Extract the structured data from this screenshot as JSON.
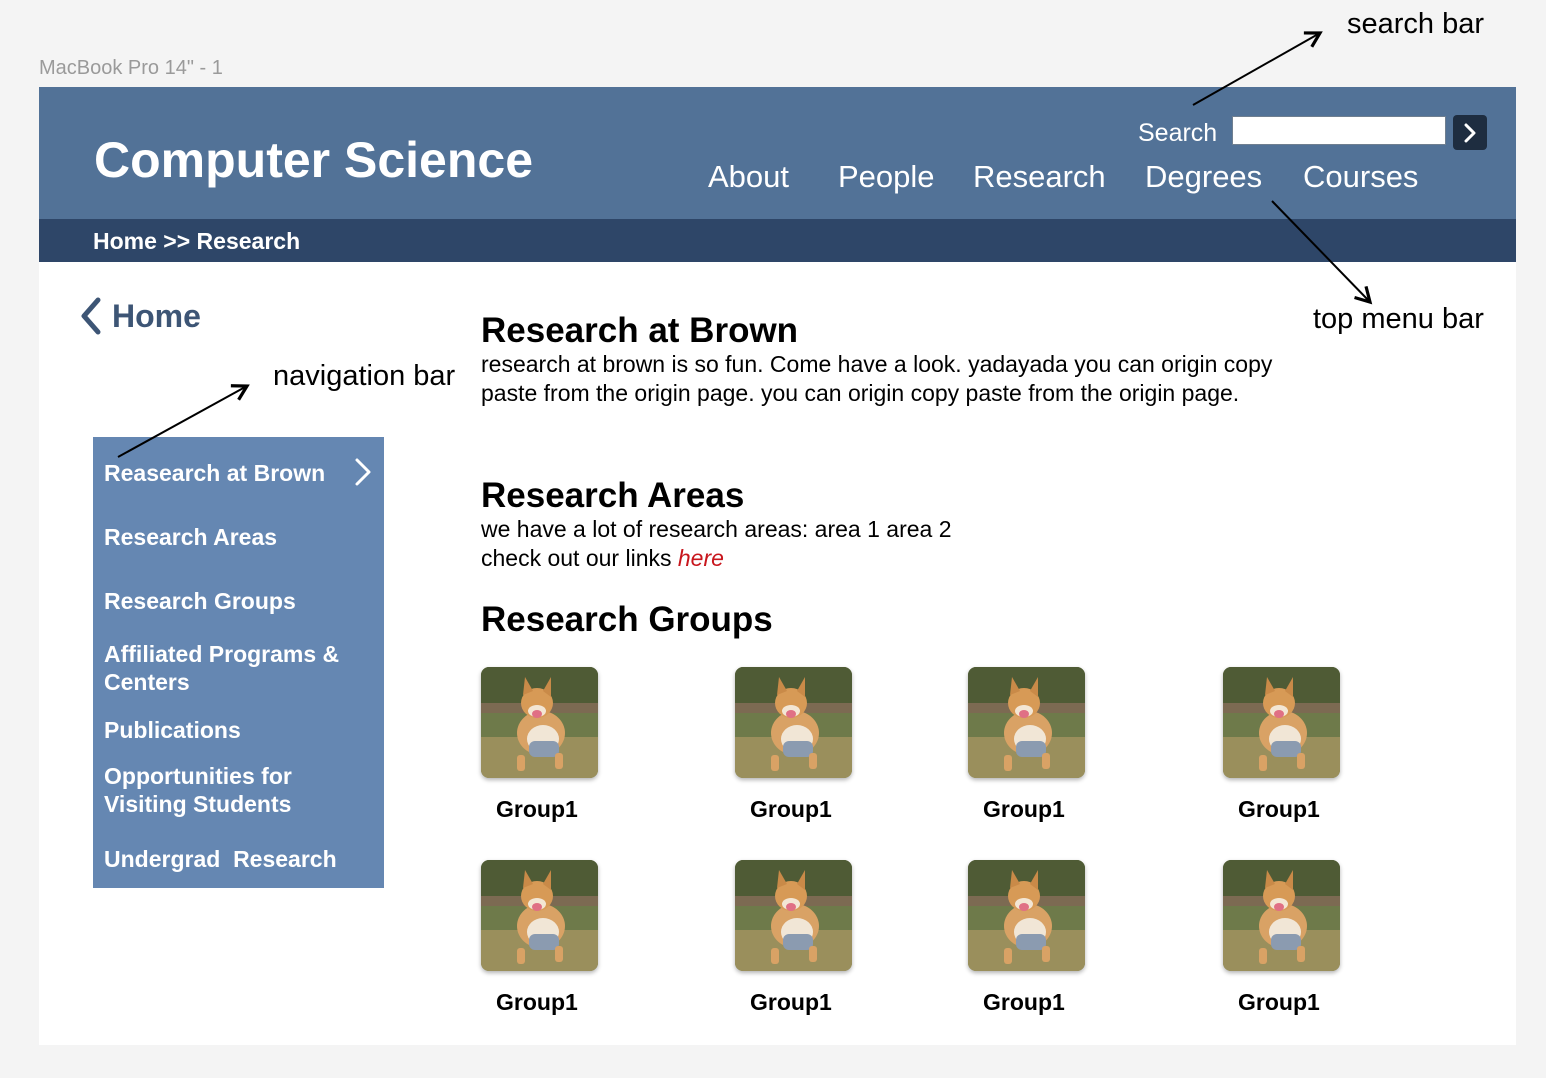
{
  "frame_label": "MacBook Pro 14\" - 1",
  "header": {
    "title": "Computer Science",
    "search_label": "Search",
    "search_value": "",
    "nav": [
      "About",
      "People",
      "Research",
      "Degrees",
      "Courses"
    ]
  },
  "breadcrumb": "Home >> Research",
  "back_link": "Home",
  "sidebar": {
    "items": [
      "Reasearch at Brown",
      "Research Areas",
      "Research Groups",
      "Affiliated Programs & Centers",
      "Publications",
      "Opportunities for Visiting Students",
      "Undergrad  Research"
    ]
  },
  "main": {
    "section1": {
      "heading": "Research at Brown",
      "text": " research at brown is so fun. Come have a look. yadayada you can origin copy paste from the origin page. you can origin  copy paste from the origin page."
    },
    "section2": {
      "heading": "Research Areas",
      "line1": " we have a lot of research areas: area 1 area 2",
      "line2_prefix": "check out our links ",
      "link_text": "here"
    },
    "section3": {
      "heading": "Research Groups",
      "groups": [
        "Group1",
        "Group1",
        "Group1",
        "Group1",
        "Group1",
        "Group1",
        "Group1",
        "Group1"
      ]
    }
  },
  "annotations": {
    "search_bar": "search bar",
    "top_menu_bar": "top menu bar",
    "navigation_bar": "navigation bar"
  },
  "colors": {
    "header": "#527297",
    "breadcrumb_bar": "#2e4668",
    "sidebar": "#6587b2",
    "link": "#c8161d"
  }
}
